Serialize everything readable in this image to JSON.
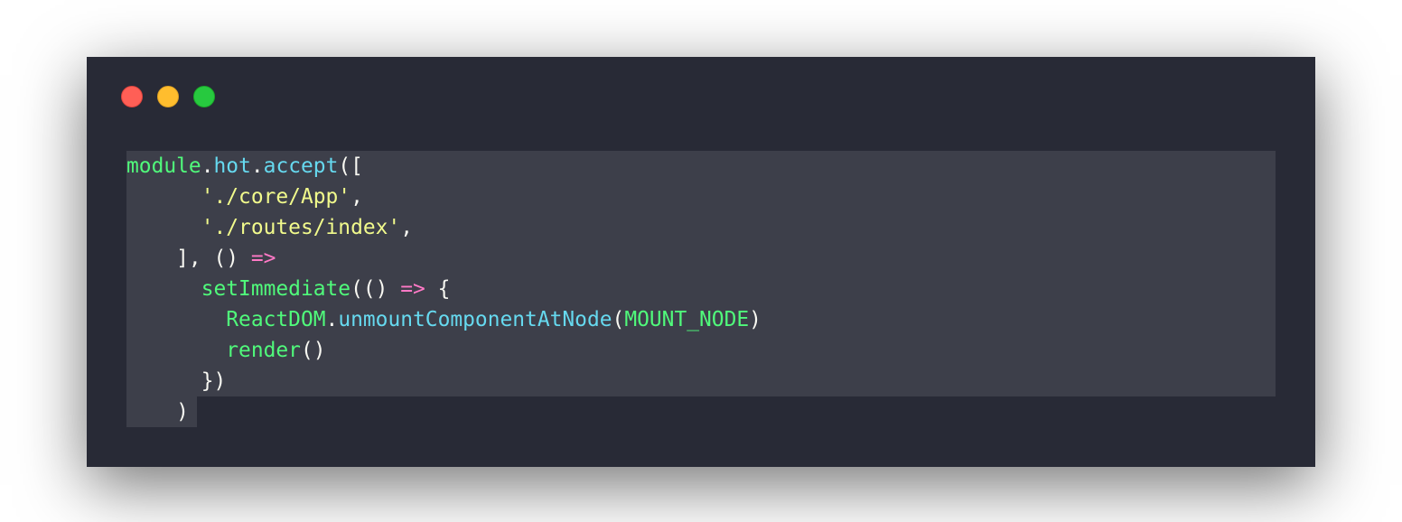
{
  "window": {
    "controls": [
      {
        "name": "close",
        "color": "#ff5f56"
      },
      {
        "name": "minimize",
        "color": "#ffbd2e"
      },
      {
        "name": "maximize",
        "color": "#27c93f"
      }
    ]
  },
  "theme": {
    "background": "#282a36",
    "selection": "#3d3f4a",
    "green": "#50fa7b",
    "cyan": "#66d9ef",
    "yellow": "#f1fa8c",
    "pink": "#ff79c6",
    "foreground": "#f8f8f2"
  },
  "code": {
    "lines": [
      [
        {
          "t": "module",
          "c": "green"
        },
        {
          "t": ".",
          "c": "white"
        },
        {
          "t": "hot",
          "c": "cyan"
        },
        {
          "t": ".",
          "c": "white"
        },
        {
          "t": "accept",
          "c": "cyan"
        },
        {
          "t": "([",
          "c": "white"
        }
      ],
      [
        {
          "t": "      ",
          "c": "white"
        },
        {
          "t": "'./core/App'",
          "c": "yellow"
        },
        {
          "t": ",",
          "c": "white"
        }
      ],
      [
        {
          "t": "      ",
          "c": "white"
        },
        {
          "t": "'./routes/index'",
          "c": "yellow"
        },
        {
          "t": ",",
          "c": "white"
        }
      ],
      [
        {
          "t": "    ], () ",
          "c": "white"
        },
        {
          "t": "=>",
          "c": "pink"
        }
      ],
      [
        {
          "t": "      ",
          "c": "white"
        },
        {
          "t": "setImmediate",
          "c": "green"
        },
        {
          "t": "(() ",
          "c": "white"
        },
        {
          "t": "=>",
          "c": "pink"
        },
        {
          "t": " {",
          "c": "white"
        }
      ],
      [
        {
          "t": "        ",
          "c": "white"
        },
        {
          "t": "ReactDOM",
          "c": "green"
        },
        {
          "t": ".",
          "c": "white"
        },
        {
          "t": "unmountComponentAtNode",
          "c": "cyan"
        },
        {
          "t": "(",
          "c": "white"
        },
        {
          "t": "MOUNT_NODE",
          "c": "green"
        },
        {
          "t": ")",
          "c": "white"
        }
      ],
      [
        {
          "t": "        ",
          "c": "white"
        },
        {
          "t": "render",
          "c": "green"
        },
        {
          "t": "()",
          "c": "white"
        }
      ],
      [
        {
          "t": "      })",
          "c": "white"
        }
      ],
      [
        {
          "t": "    )",
          "c": "white"
        }
      ]
    ]
  }
}
